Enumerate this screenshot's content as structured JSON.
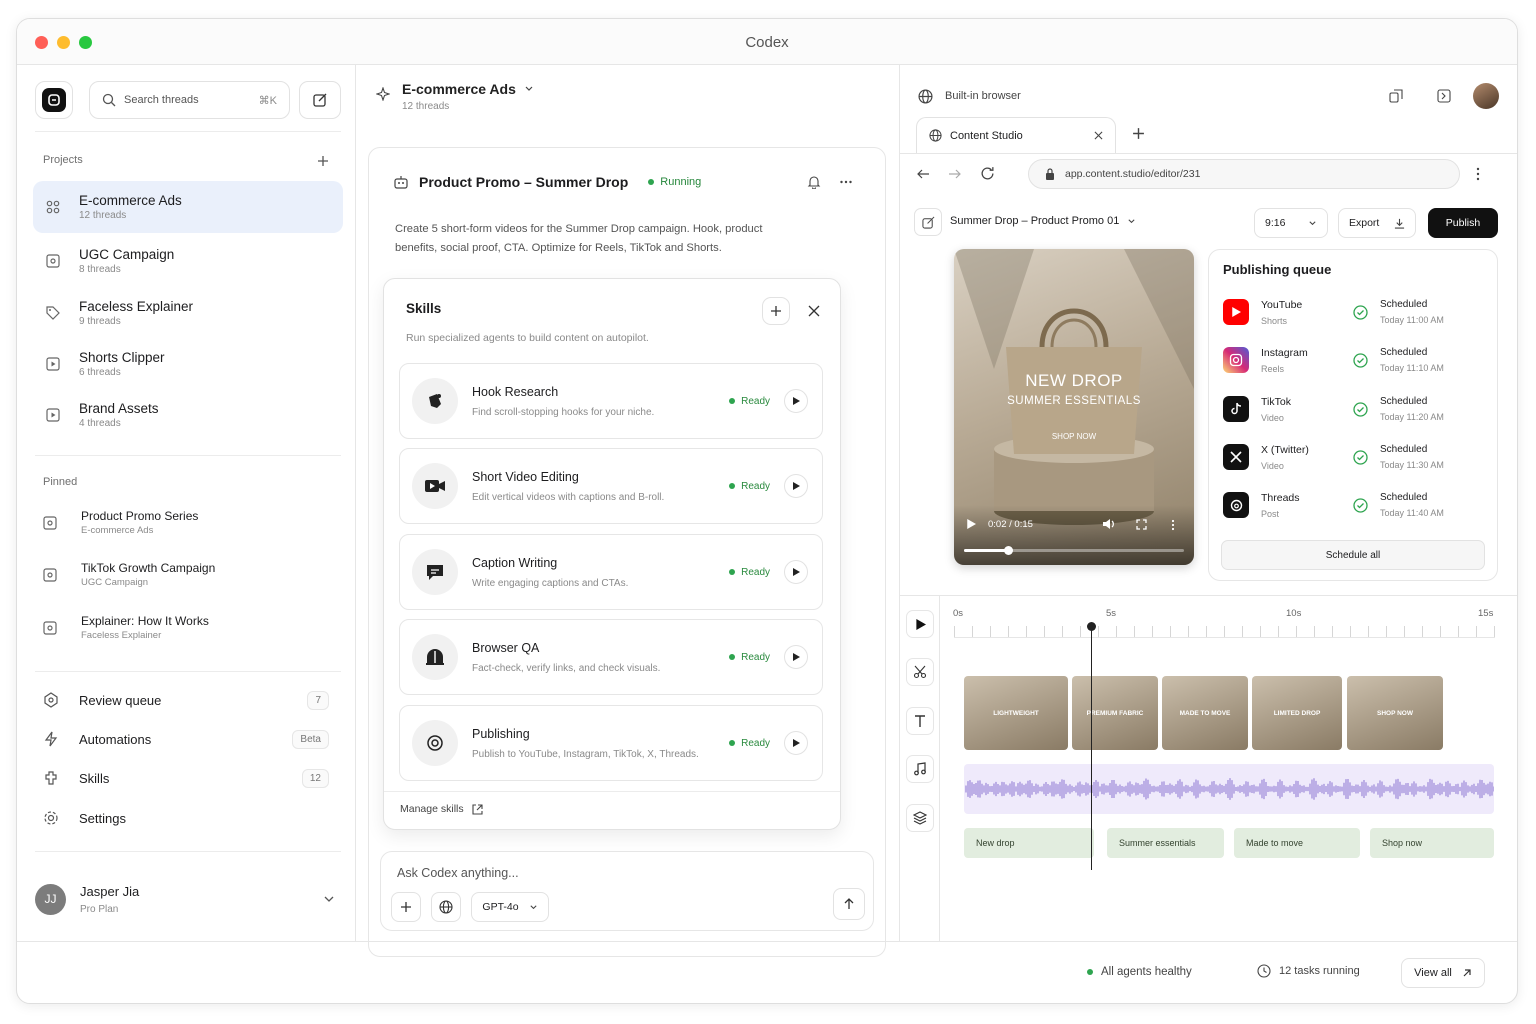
{
  "window": {
    "title": "Codex"
  },
  "sidebar": {
    "search_placeholder": "Search threads",
    "search_shortcut": "⌘K",
    "projects_label": "Projects",
    "projects": [
      {
        "name": "E-commerce Ads",
        "threads": "12 threads",
        "icon": "grid-icon"
      },
      {
        "name": "UGC Campaign",
        "threads": "8 threads",
        "icon": "square-icon"
      },
      {
        "name": "Faceless Explainer",
        "threads": "9 threads",
        "icon": "tag-icon"
      },
      {
        "name": "Shorts Clipper",
        "threads": "6 threads",
        "icon": "play-square-icon"
      },
      {
        "name": "Brand Assets",
        "threads": "4 threads",
        "icon": "play-square-icon"
      }
    ],
    "pinned_label": "Pinned",
    "pinned": [
      {
        "name": "Product Promo Series",
        "project": "E-commerce Ads"
      },
      {
        "name": "TikTok Growth Campaign",
        "project": "UGC Campaign"
      },
      {
        "name": "Explainer: How It Works",
        "project": "Faceless Explainer"
      }
    ],
    "nav": [
      {
        "label": "Review queue",
        "badge": "7"
      },
      {
        "label": "Automations",
        "badge": "Beta"
      },
      {
        "label": "Skills",
        "badge": "12"
      },
      {
        "label": "Settings",
        "badge": ""
      }
    ],
    "user": {
      "initials": "JJ",
      "name": "Jasper Jia",
      "plan": "Pro Plan"
    }
  },
  "chat": {
    "project": "E-commerce Ads",
    "threads": "12 threads",
    "task_title": "Product Promo – Summer Drop",
    "status": "Running",
    "description": "Create 5 short-form videos for the Summer Drop campaign. Hook, product benefits, social proof, CTA. Optimize for Reels, TikTok and Shorts.",
    "skills_panel": {
      "title": "Skills",
      "subtitle": "Run specialized agents to build content on autopilot.",
      "items": [
        {
          "name": "Hook Research",
          "desc": "Find scroll-stopping hooks for your niche.",
          "status": "Ready"
        },
        {
          "name": "Short Video Editing",
          "desc": "Edit vertical videos with captions and B-roll.",
          "status": "Ready"
        },
        {
          "name": "Caption Writing",
          "desc": "Write engaging captions and CTAs.",
          "status": "Ready"
        },
        {
          "name": "Browser QA",
          "desc": "Fact-check, verify links, and check visuals.",
          "status": "Ready"
        },
        {
          "name": "Publishing",
          "desc": "Publish to YouTube, Instagram, TikTok, X, Threads.",
          "status": "Ready"
        }
      ],
      "manage_label": "Manage skills"
    },
    "input_placeholder": "Ask Codex anything...",
    "model": "GPT-4o"
  },
  "browser": {
    "label": "Built-in browser",
    "tab": "Content Studio",
    "url": "app.content.studio/editor/231",
    "doc_title": "Summer Drop – Product Promo 01",
    "aspect": "9:16",
    "export_label": "Export",
    "publish_label": "Publish",
    "video": {
      "headline": "NEW DROP",
      "subhead": "SUMMER ESSENTIALS",
      "cta": "SHOP NOW",
      "time": "0:02 / 0:15",
      "progress": 0.2
    },
    "queue": {
      "title": "Publishing queue",
      "items": [
        {
          "platform": "YouTube",
          "format": "Shorts",
          "status": "Scheduled",
          "time": "Today 11:00 AM",
          "color": "#ff0000"
        },
        {
          "platform": "Instagram",
          "format": "Reels",
          "status": "Scheduled",
          "time": "Today 11:10 AM",
          "color": "#d62976"
        },
        {
          "platform": "TikTok",
          "format": "Video",
          "status": "Scheduled",
          "time": "Today 11:20 AM",
          "color": "#111111"
        },
        {
          "platform": "X (Twitter)",
          "format": "Video",
          "status": "Scheduled",
          "time": "Today 11:30 AM",
          "color": "#111111"
        },
        {
          "platform": "Threads",
          "format": "Post",
          "status": "Scheduled",
          "time": "Today 11:40 AM",
          "color": "#111111"
        }
      ],
      "schedule_all": "Schedule all"
    },
    "timeline": {
      "ruler": [
        "0s",
        "5s",
        "10s",
        "15s"
      ],
      "clips": [
        "LIGHTWEIGHT",
        "PREMIUM FABRIC",
        "MADE TO MOVE",
        "LIMITED DROP",
        "SHOP NOW"
      ],
      "captions": [
        "New drop",
        "Summer essentials",
        "Made to move",
        "Shop now"
      ]
    }
  },
  "footer": {
    "health": "All agents healthy",
    "tasks": "12 tasks running",
    "view_all": "View all"
  },
  "colors": {
    "accent_green": "#2ea44f",
    "active_bg": "#eaf0fb",
    "audio": "#9b87d9"
  }
}
